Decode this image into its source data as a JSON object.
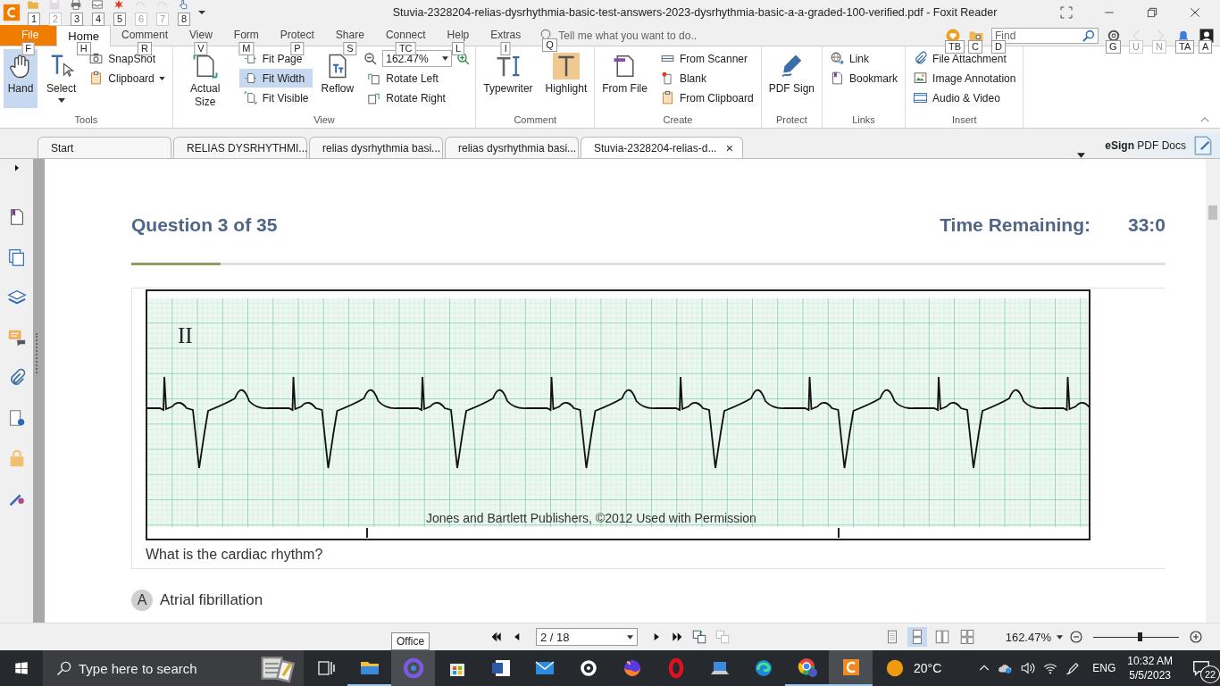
{
  "title_bar": {
    "title": "Stuvia-2328204-relias-dysrhythmia-basic-test-answers-2023-dysrhythmia-basic-a-a-graded-100-verified.pdf - Foxit Reader",
    "quick_access": [
      {
        "keytip": "1",
        "disabled": false
      },
      {
        "keytip": "2",
        "disabled": true
      },
      {
        "keytip": "3",
        "disabled": false
      },
      {
        "keytip": "4",
        "disabled": false
      },
      {
        "keytip": "5",
        "disabled": false
      },
      {
        "keytip": "6",
        "disabled": true
      },
      {
        "keytip": "7",
        "disabled": true
      },
      {
        "keytip": "8",
        "disabled": false
      }
    ]
  },
  "menu": {
    "tabs": [
      {
        "label": "File",
        "keytip": "F",
        "kind": "file",
        "selected": false
      },
      {
        "label": "Home",
        "keytip": "H",
        "kind": "tab",
        "selected": true
      },
      {
        "label": "Comment",
        "keytip": "R",
        "kind": "tab",
        "selected": false
      },
      {
        "label": "View",
        "keytip": "V",
        "kind": "tab",
        "selected": false
      },
      {
        "label": "Form",
        "keytip": "M",
        "kind": "tab",
        "selected": false
      },
      {
        "label": "Protect",
        "keytip": "P",
        "kind": "tab",
        "selected": false
      },
      {
        "label": "Share",
        "keytip": "S",
        "kind": "tab",
        "selected": false
      },
      {
        "label": "Connect",
        "keytip": "TC",
        "kind": "tab",
        "selected": false
      },
      {
        "label": "Help",
        "keytip": "L",
        "kind": "tab",
        "selected": false
      },
      {
        "label": "Extras",
        "keytip": "I",
        "kind": "tab",
        "selected": false
      }
    ],
    "tell_me": {
      "placeholder": "Tell me what you want to do..",
      "keytip": "Q"
    },
    "left_tools": [
      {
        "keytip": "TB",
        "disabled": false
      },
      {
        "keytip": "C",
        "disabled": false
      }
    ],
    "find": {
      "placeholder": "Find",
      "keytip": "D"
    },
    "right_tools": [
      {
        "keytip": "G",
        "disabled": false
      },
      {
        "keytip": "U",
        "disabled": true
      },
      {
        "keytip": "N",
        "disabled": true
      },
      {
        "keytip": "TA",
        "disabled": false
      },
      {
        "keytip": "A",
        "disabled": false
      }
    ]
  },
  "ribbon": [
    {
      "label": "Tools",
      "items": [
        {
          "label": "Hand",
          "kind": "large",
          "selected": true
        },
        {
          "label": "Select",
          "kind": "large",
          "selected": false,
          "dropdown": true
        },
        {
          "label": "SnapShot",
          "kind": "small",
          "selected": false
        },
        {
          "label": "Clipboard",
          "kind": "small",
          "selected": false,
          "dropdown": true
        }
      ]
    },
    {
      "label": "View",
      "items": [
        {
          "label": "Actual Size",
          "kind": "large",
          "selected": false
        },
        {
          "label": "Fit Page",
          "kind": "small",
          "selected": false
        },
        {
          "label": "Fit Width",
          "kind": "small",
          "selected": true
        },
        {
          "label": "Fit Visible",
          "kind": "small",
          "selected": false
        },
        {
          "label": "Reflow",
          "kind": "large",
          "selected": false
        },
        {
          "value": "162.47%",
          "kind": "zoom"
        },
        {
          "label": "Rotate Left",
          "kind": "small",
          "selected": false
        },
        {
          "label": "Rotate Right",
          "kind": "small",
          "selected": false
        }
      ]
    },
    {
      "label": "Comment",
      "items": [
        {
          "label": "Typewriter",
          "kind": "large",
          "selected": false
        },
        {
          "label": "Highlight",
          "kind": "large",
          "selected": false
        }
      ]
    },
    {
      "label": "Create",
      "items": [
        {
          "label": "From File",
          "kind": "large",
          "selected": false
        },
        {
          "label": "From Scanner",
          "kind": "small",
          "selected": false
        },
        {
          "label": "Blank",
          "kind": "small",
          "selected": false
        },
        {
          "label": "From Clipboard",
          "kind": "small",
          "selected": false
        }
      ]
    },
    {
      "label": "Protect",
      "items": [
        {
          "label": "PDF Sign",
          "kind": "large",
          "selected": false
        }
      ]
    },
    {
      "label": "Links",
      "items": [
        {
          "label": "Link",
          "kind": "small",
          "selected": false
        },
        {
          "label": "Bookmark",
          "kind": "small",
          "selected": false
        }
      ]
    },
    {
      "label": "Insert",
      "items": [
        {
          "label": "File Attachment",
          "kind": "small",
          "selected": false
        },
        {
          "label": "Image Annotation",
          "kind": "small",
          "selected": false
        },
        {
          "label": "Audio & Video",
          "kind": "small",
          "selected": false
        }
      ]
    }
  ],
  "doc_tabs": [
    {
      "label": "Start",
      "selected": false
    },
    {
      "label": "RELIAS DYSRHYTHMI...",
      "selected": false
    },
    {
      "label": "relias dysrhythmia basi...",
      "selected": false
    },
    {
      "label": "relias dysrhythmia basi...",
      "selected": false
    },
    {
      "label": "Stuvia-2328204-relias-d...",
      "selected": true,
      "close": "×"
    }
  ],
  "esign": "**eSign** PDF Docs",
  "page": {
    "question": "Question 3 of 35",
    "time_label": "Time Remaining:",
    "time_value": "33:0",
    "progress": {
      "level": 0.086
    },
    "figure": {
      "lead": "II",
      "credit": "Jones and Bartlett Publishers, ©2012 Used with Permission"
    },
    "prompt": "What is the cardiac rhythm?",
    "options": [
      {
        "letter": "A",
        "text": "Atrial fibrillation"
      }
    ]
  },
  "status_bar": {
    "page_field": "2 / 18",
    "view_modes": [
      {
        "selected": false
      },
      {
        "selected": true
      },
      {
        "selected": false
      },
      {
        "selected": false
      }
    ],
    "zoom": {
      "value": "162.47%",
      "level": 0.54
    }
  },
  "tooltip": "Office",
  "taskbar": {
    "search_placeholder": "Type here to search",
    "apps": [
      {
        "running": false,
        "active": false
      },
      {
        "running": true,
        "active": false
      },
      {
        "running": false,
        "active": true
      },
      {
        "running": false,
        "active": false
      },
      {
        "running": false,
        "active": false
      },
      {
        "running": false,
        "active": false
      },
      {
        "running": false,
        "active": false
      },
      {
        "running": false,
        "active": false
      },
      {
        "running": false,
        "active": false
      },
      {
        "running": false,
        "active": false
      },
      {
        "running": false,
        "active": false
      },
      {
        "running": true,
        "active": false
      },
      {
        "running": true,
        "active": true
      }
    ],
    "weather": "20°C",
    "language": "ENG",
    "time": "10:32 AM",
    "date": "5/5/2023",
    "notifications": "22"
  }
}
